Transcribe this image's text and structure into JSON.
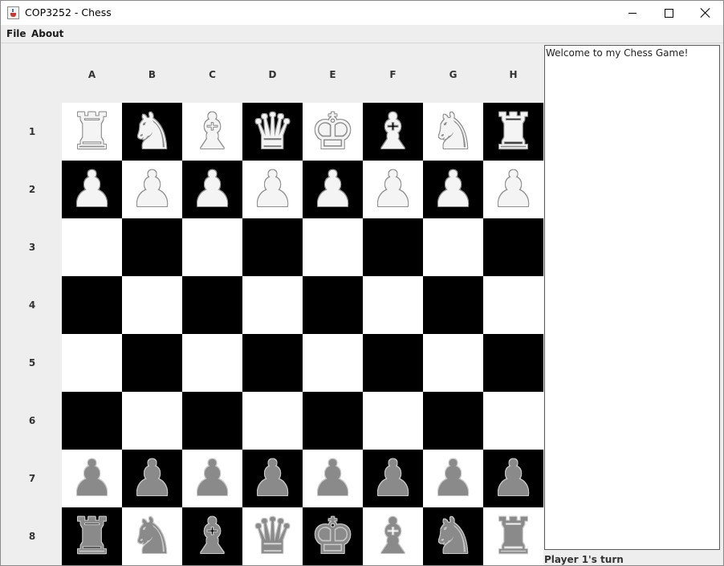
{
  "window": {
    "title": "COP3252 - Chess"
  },
  "menu": {
    "items": [
      "File",
      "About"
    ]
  },
  "board": {
    "columns": [
      "A",
      "B",
      "C",
      "D",
      "E",
      "F",
      "G",
      "H"
    ],
    "rows": [
      "1",
      "2",
      "3",
      "4",
      "5",
      "6",
      "7",
      "8"
    ],
    "pieces": [
      [
        "♜",
        "♞",
        "♝",
        "♛",
        "♚",
        "♝",
        "♞",
        "♜"
      ],
      [
        "♟",
        "♟",
        "♟",
        "♟",
        "♟",
        "♟",
        "♟",
        "♟"
      ],
      [
        "",
        "",
        "",
        "",
        "",
        "",
        "",
        ""
      ],
      [
        "",
        "",
        "",
        "",
        "",
        "",
        "",
        ""
      ],
      [
        "",
        "",
        "",
        "",
        "",
        "",
        "",
        ""
      ],
      [
        "",
        "",
        "",
        "",
        "",
        "",
        "",
        ""
      ],
      [
        "♟",
        "♟",
        "♟",
        "♟",
        "♟",
        "♟",
        "♟",
        "♟"
      ],
      [
        "♜",
        "♞",
        "♝",
        "♛",
        "♚",
        "♝",
        "♞",
        "♜"
      ]
    ],
    "piece_colors": {
      "1": "light",
      "2": "light",
      "7": "dark",
      "8": "dark"
    },
    "square_colors": {
      "light": "#ffffff",
      "dark": "#000000"
    }
  },
  "log": {
    "text": "Welcome to my Chess Game!"
  },
  "status": {
    "text": "Player 1's turn"
  }
}
